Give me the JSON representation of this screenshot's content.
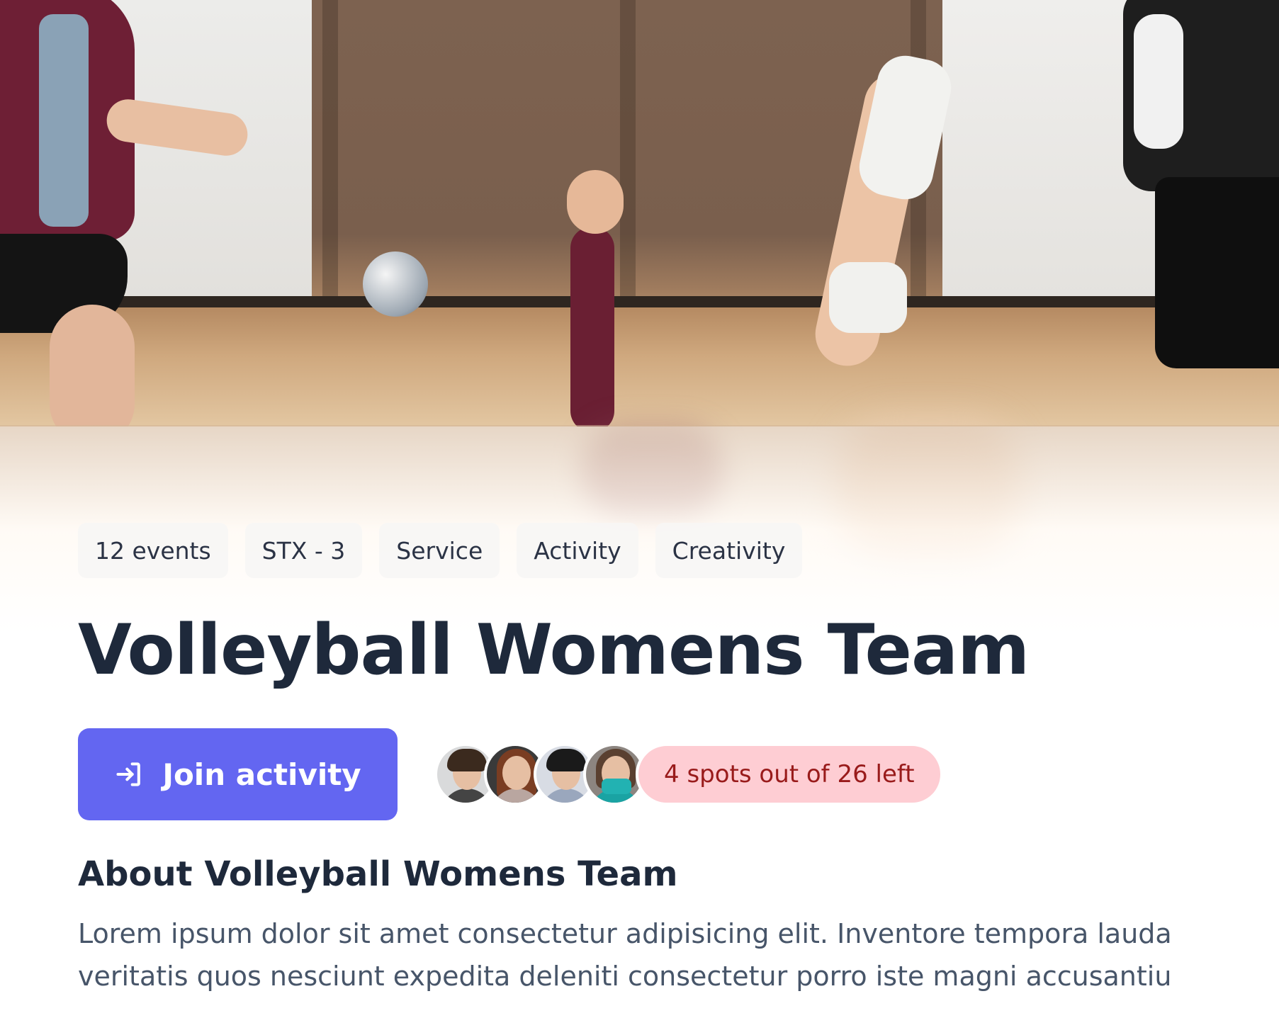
{
  "tags": [
    "12 events",
    "STX - 3",
    "Service",
    "Activity",
    "Creativity"
  ],
  "title": "Volleyball Womens Team",
  "join_button": {
    "label": "Join activity",
    "icon": "login-arrow-icon"
  },
  "participants": {
    "avatars": [
      "avatar-1",
      "avatar-2",
      "avatar-3",
      "avatar-4"
    ],
    "spots_label": "4 spots out of 26 left"
  },
  "about": {
    "heading": "About Volleyball Womens Team",
    "line1": "Lorem ipsum dolor sit amet consectetur adipisicing elit. Inventore tempora lauda",
    "line2": "veritatis quos nesciunt expedita deleniti consectetur porro iste magni accusantiu"
  },
  "colors": {
    "accent": "#6366f1",
    "title": "#1e293b",
    "badge_bg": "#fecdd3",
    "badge_text": "#991b1b",
    "body_text": "#475569"
  }
}
